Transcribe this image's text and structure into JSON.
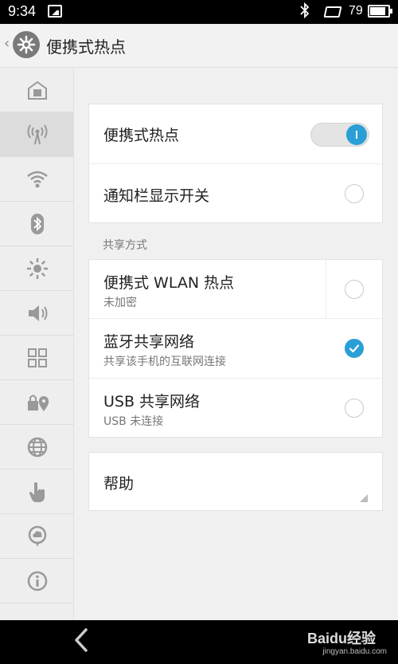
{
  "status_bar": {
    "time": "9:34",
    "battery": "79",
    "icons": [
      "picture-icon",
      "bluetooth-icon",
      "sim-icon",
      "battery-icon"
    ]
  },
  "header": {
    "title": "便携式热点",
    "icon": "gear-icon"
  },
  "sidebar": {
    "items": [
      {
        "icon": "home-icon",
        "active": false
      },
      {
        "icon": "hotspot-icon",
        "active": true
      },
      {
        "icon": "wifi-icon",
        "active": false
      },
      {
        "icon": "bluetooth-icon",
        "active": false
      },
      {
        "icon": "brightness-icon",
        "active": false
      },
      {
        "icon": "sound-icon",
        "active": false
      },
      {
        "icon": "apps-grid-icon",
        "active": false
      },
      {
        "icon": "lock-location-icon",
        "active": false
      },
      {
        "icon": "globe-icon",
        "active": false
      },
      {
        "icon": "hand-pointer-icon",
        "active": false
      },
      {
        "icon": "cloud-chat-icon",
        "active": false
      },
      {
        "icon": "info-icon",
        "active": false
      }
    ]
  },
  "main": {
    "hotspot": {
      "label": "便携式热点",
      "enabled": true
    },
    "notify_switch": {
      "label": "通知栏显示开关",
      "checked": false
    },
    "section_label": "共享方式",
    "share_methods": [
      {
        "title": "便携式 WLAN 热点",
        "subtitle": "未加密",
        "checked": false
      },
      {
        "title": "蓝牙共享网络",
        "subtitle": "共享该手机的互联网连接",
        "checked": true
      },
      {
        "title": "USB 共享网络",
        "subtitle": "USB 未连接",
        "checked": false
      }
    ],
    "help": {
      "label": "帮助"
    }
  },
  "nav": {
    "back_icon": "back-chevron-icon"
  },
  "watermark": {
    "logo_text": "Baidu经验",
    "url": "jingyan.baidu.com"
  },
  "colors": {
    "accent": "#2a9fd6",
    "background": "#f0f0f0",
    "sidebar": "#eeeeee"
  }
}
